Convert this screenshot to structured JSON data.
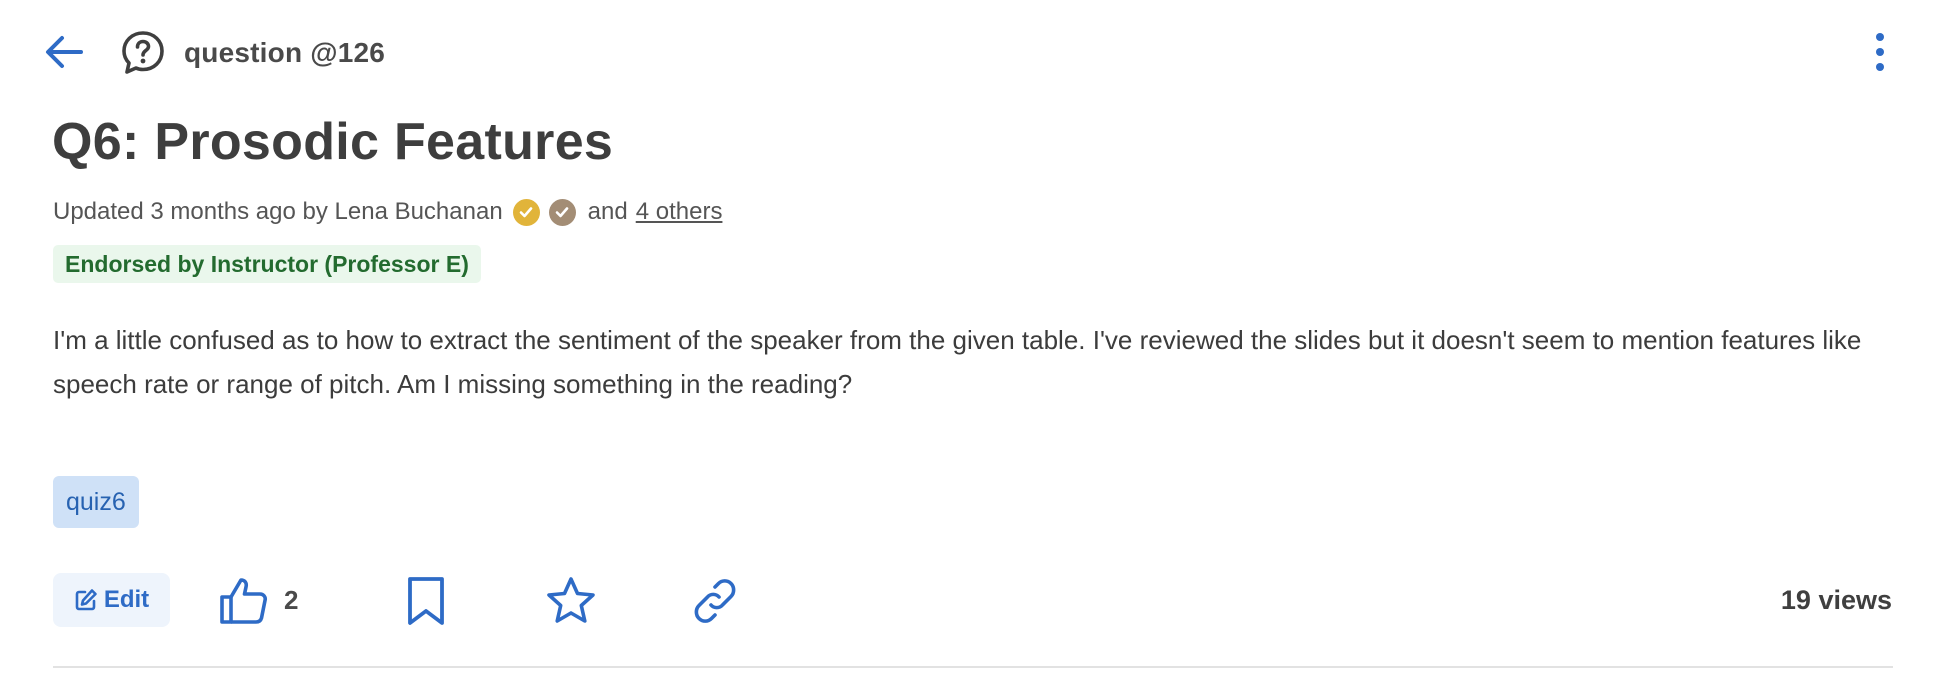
{
  "header": {
    "back_icon": "arrow-left-icon",
    "post_type_icon": "question-bubble-icon",
    "question_id": "question @126",
    "more_icon": "more-vertical-icon"
  },
  "post": {
    "title": "Q6: Prosodic Features",
    "meta": {
      "prefix": "Updated 3 months ago by Lena Buchanan",
      "badges": [
        "gold-check-icon",
        "grey-check-icon"
      ],
      "and_text": "and",
      "others_link": "4 others"
    },
    "endorsement": "Endorsed by Instructor (Professor E)",
    "body": "I'm a little confused as to how to extract the sentiment of the speaker from the given table.  I've reviewed the slides but it doesn't seem to mention features like speech rate or range of pitch.  Am I missing something in the reading?",
    "tags": [
      "quiz6"
    ]
  },
  "actions": {
    "edit_label": "Edit",
    "like_count": "2",
    "views": "19 views"
  },
  "colors": {
    "accent": "#2e6bc6",
    "endorsed_bg": "#eaf7ec",
    "endorsed_text": "#236b2f",
    "tag_bg": "#cfe1f7",
    "badge_gold": "#e1b43a",
    "badge_grey": "#a38d75"
  }
}
